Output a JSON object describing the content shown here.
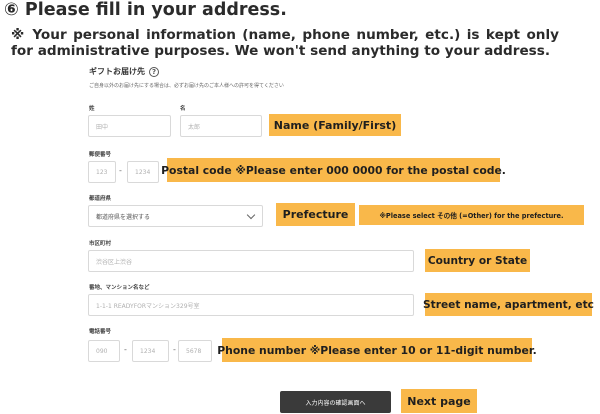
{
  "header": {
    "title": "⑥ Please fill in your address.",
    "notice": "※ Your personal information (name, phone number, etc.) is kept only for administrative purposes. We won't send anything to your address."
  },
  "form": {
    "heading": "ギフトお届け先",
    "help_icon": "?",
    "description": "ご自身以外のお届け先にする場合は、必ずお届け先のご本人様への許可を得てください",
    "last_name": {
      "label": "姓",
      "placeholder": "田中"
    },
    "first_name": {
      "label": "名",
      "placeholder": "太郎"
    },
    "postal": {
      "label": "郵便番号",
      "part1_placeholder": "123",
      "separator": "-",
      "part2_placeholder": "1234"
    },
    "prefecture": {
      "label": "都道府県",
      "selected": "都道府県を選択する"
    },
    "city": {
      "label": "市区町村",
      "placeholder": "渋谷区上渋谷"
    },
    "street": {
      "label": "番地、マンション名など",
      "placeholder": "1-1-1 READYFORマンション329号室"
    },
    "phone": {
      "label": "電話番号",
      "part1_placeholder": "090",
      "part2_placeholder": "1234",
      "part3_placeholder": "5678",
      "separator": "-"
    },
    "submit_label": "入力内容の確認画面へ"
  },
  "callouts": {
    "name": "Name (Family/First)",
    "postal": "Postal code  ※Please enter 000 0000 for the postal code.",
    "prefecture": "Prefecture",
    "prefecture_note": "※Please select その他 (=Other) for the prefecture.",
    "city": "Country or State",
    "street": "Street name, apartment, etc",
    "phone": "Phone number  ※Please enter 10 or 11-digit number.",
    "next": "Next page"
  },
  "colors": {
    "callout_bg": "#f9b84a",
    "button_bg": "#3a3a3a"
  }
}
